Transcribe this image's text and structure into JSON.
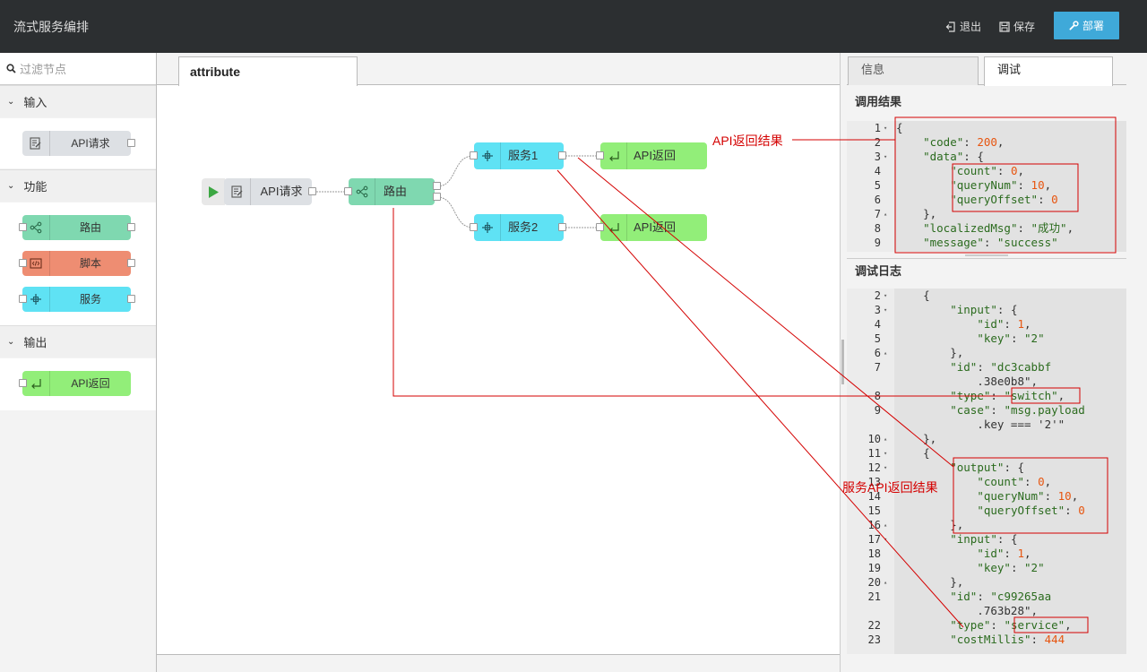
{
  "header": {
    "title": "流式服务编排",
    "exit_label": "退出",
    "save_label": "保存",
    "deploy_label": "部署"
  },
  "palette": {
    "filter_placeholder": "过滤节点",
    "categories": [
      {
        "label": "输入",
        "nodes": [
          {
            "label": "API请求",
            "color": "#dde0e4"
          }
        ]
      },
      {
        "label": "功能",
        "nodes": [
          {
            "label": "路由",
            "color": "#7fd8b0"
          },
          {
            "label": "脚本",
            "color": "#ee8d72"
          },
          {
            "label": "服务",
            "color": "#5fe2f4"
          }
        ]
      },
      {
        "label": "输出",
        "nodes": [
          {
            "label": "API返回",
            "color": "#92ee79"
          }
        ]
      }
    ]
  },
  "workspace": {
    "tab_label": "attribute",
    "nodes": {
      "api_request": "API请求",
      "router": "路由",
      "service1": "服务1",
      "service2": "服务2",
      "api_return_1": "API返回",
      "api_return_2": "API返回"
    }
  },
  "sidebar": {
    "tabs": [
      "信息",
      "调试"
    ],
    "result_title": "调用结果",
    "log_title": "调试日志",
    "result_lines": [
      {
        "n": "1",
        "f": "▾",
        "t": "{"
      },
      {
        "n": "2",
        "f": "",
        "t": "    \"code\": 200,"
      },
      {
        "n": "3",
        "f": "▾",
        "t": "    \"data\": {"
      },
      {
        "n": "4",
        "f": "",
        "t": "        \"count\": 0,"
      },
      {
        "n": "5",
        "f": "",
        "t": "        \"queryNum\": 10,"
      },
      {
        "n": "6",
        "f": "",
        "t": "        \"queryOffset\": 0"
      },
      {
        "n": "7",
        "f": "▴",
        "t": "    },"
      },
      {
        "n": "8",
        "f": "",
        "t": "    \"localizedMsg\": \"成功\","
      },
      {
        "n": "9",
        "f": "",
        "t": "    \"message\": \"success\""
      }
    ],
    "log_lines": [
      {
        "n": "2",
        "f": "▾",
        "t": "    {"
      },
      {
        "n": "3",
        "f": "▾",
        "t": "        \"input\": {"
      },
      {
        "n": "4",
        "f": "",
        "t": "            \"id\": 1,"
      },
      {
        "n": "5",
        "f": "",
        "t": "            \"key\": \"2\""
      },
      {
        "n": "6",
        "f": "▴",
        "t": "        },"
      },
      {
        "n": "7",
        "f": "",
        "t": "        \"id\": \"dc3cabbf"
      },
      {
        "n": "",
        "f": "",
        "t": "            .38e0b8\","
      },
      {
        "n": "8",
        "f": "",
        "t": "        \"type\": \"switch\","
      },
      {
        "n": "9",
        "f": "",
        "t": "        \"case\": \"msg.payload"
      },
      {
        "n": "",
        "f": "",
        "t": "            .key === '2'\""
      },
      {
        "n": "10",
        "f": "▴",
        "t": "    },"
      },
      {
        "n": "11",
        "f": "▾",
        "t": "    {"
      },
      {
        "n": "12",
        "f": "▾",
        "t": "        \"output\": {"
      },
      {
        "n": "13",
        "f": "",
        "t": "            \"count\": 0,"
      },
      {
        "n": "14",
        "f": "",
        "t": "            \"queryNum\": 10,"
      },
      {
        "n": "15",
        "f": "",
        "t": "            \"queryOffset\": 0"
      },
      {
        "n": "16",
        "f": "▴",
        "t": "        },"
      },
      {
        "n": "17",
        "f": "▾",
        "t": "        \"input\": {"
      },
      {
        "n": "18",
        "f": "",
        "t": "            \"id\": 1,"
      },
      {
        "n": "19",
        "f": "",
        "t": "            \"key\": \"2\""
      },
      {
        "n": "20",
        "f": "▴",
        "t": "        },"
      },
      {
        "n": "21",
        "f": "",
        "t": "        \"id\": \"c99265aa"
      },
      {
        "n": "",
        "f": "",
        "t": "            .763b28\","
      },
      {
        "n": "22",
        "f": "",
        "t": "        \"type\": \"service\","
      },
      {
        "n": "23",
        "f": "",
        "t": "        \"costMillis\": 444"
      }
    ]
  },
  "annotations": {
    "api_result": "API返回结果",
    "service_result": "服务API返回结果"
  },
  "colors": {
    "header_bg": "#2c2f31",
    "deploy_bg": "#3fa9d9",
    "annotation": "#d40000"
  }
}
